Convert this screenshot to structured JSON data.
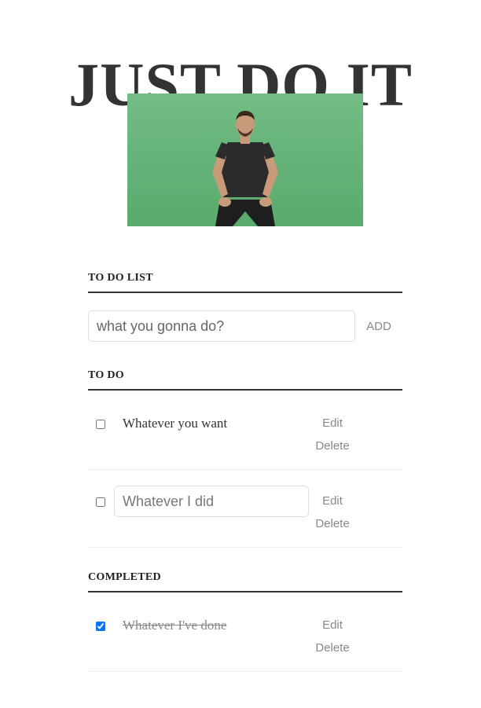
{
  "header": {
    "title": "JUST DO IT"
  },
  "hero_image": {
    "description_icon": "motivational-man-green-screen"
  },
  "new_task": {
    "section_title": "TO DO LIST",
    "placeholder": "what you gonna do?",
    "add_label": "ADD"
  },
  "todo": {
    "section_title": "TO DO",
    "items": [
      {
        "label": "Whatever you want",
        "checked": false,
        "editing": false,
        "edit_label": "Edit",
        "delete_label": "Delete"
      },
      {
        "label": "",
        "placeholder": "Whatever I did",
        "checked": false,
        "editing": true,
        "edit_label": "Edit",
        "delete_label": "Delete"
      }
    ]
  },
  "completed": {
    "section_title": "COMPLETED",
    "items": [
      {
        "label": "Whatever I've done",
        "checked": true,
        "edit_label": "Edit",
        "delete_label": "Delete"
      }
    ]
  },
  "colors": {
    "heading": "#333333",
    "hero_green": "#66b47a",
    "muted_button": "#888888",
    "divider": "#333333"
  }
}
